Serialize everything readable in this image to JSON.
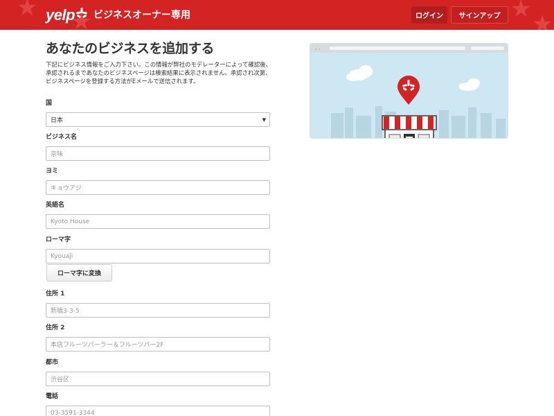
{
  "header": {
    "logo": "yelp",
    "title": "ビジネスオーナー専用",
    "login_label": "ログイン",
    "signup_label": "サインアップ",
    "colors": {
      "brand": "#d32323"
    }
  },
  "page": {
    "heading": "あなたのビジネスを追加する",
    "intro": "下記にビジネス情報をご入力下さい。この情報が弊社のモデレーターによって確認後、承認されるまであなたのビジネスページは検索結果に表示されません。承認され次第、ビジネスページを登録する方法がEメールで送信されます。"
  },
  "form": {
    "country": {
      "label": "国",
      "value": "日本"
    },
    "business_name": {
      "label": "ビジネス名",
      "placeholder": "京味"
    },
    "reading": {
      "label": "ヨミ",
      "placeholder": "キョウアジ"
    },
    "english_name": {
      "label": "英語名",
      "placeholder": "Kyoto House"
    },
    "romaji": {
      "label": "ローマ字",
      "placeholder": "Kyouaji"
    },
    "convert_label": "ローマ字に変換",
    "address1": {
      "label": "住所 1",
      "placeholder": "新橋3-3-5"
    },
    "address2": {
      "label": "住所 2",
      "placeholder": "本店フルーツパーラー＆フルーツバー2F"
    },
    "city": {
      "label": "都市",
      "placeholder": "渋谷区"
    },
    "phone": {
      "label": "電話",
      "placeholder": "03-3591-3344"
    }
  },
  "illustration": {
    "icons": [
      "yelp-map-pin-icon",
      "storefront-icon",
      "cloud-icon"
    ]
  }
}
